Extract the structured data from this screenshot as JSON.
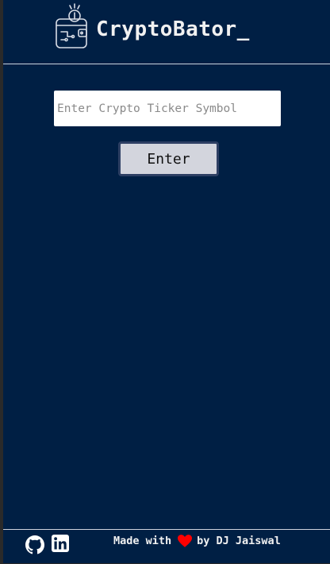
{
  "header": {
    "brand": "CryptoBator_",
    "logo_icon": "wallet-coin-icon"
  },
  "search": {
    "placeholder": "Enter Crypto Ticker Symbol",
    "value": ""
  },
  "actions": {
    "enter_label": "Enter"
  },
  "footer": {
    "github_icon": "github-icon",
    "linkedin_icon": "linkedin-icon",
    "made_with": "Made with",
    "heart_icon": "heart-icon",
    "by_author": "by DJ Jaiswal"
  },
  "colors": {
    "background": "#001f44",
    "heart": "#ff0000",
    "button_bg": "#d3d5dd",
    "text": "#f1f1f1"
  }
}
